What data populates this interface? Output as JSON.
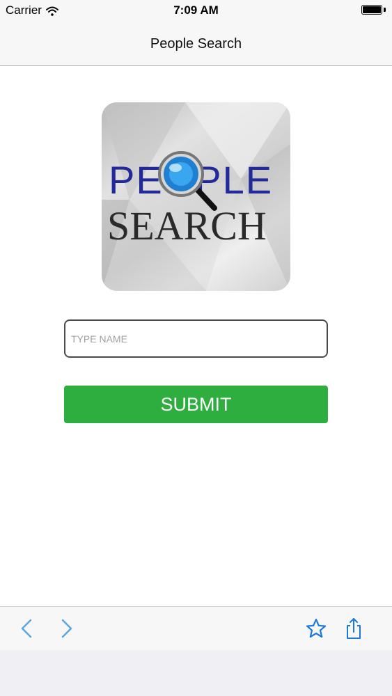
{
  "status_bar": {
    "carrier": "Carrier",
    "time": "7:09 AM",
    "wifi_icon": "wifi-icon",
    "battery_icon": "battery-icon"
  },
  "nav": {
    "title": "People Search"
  },
  "logo": {
    "line1": "PEOPLE",
    "line2": "SEARCH",
    "icon": "magnifying-glass-icon"
  },
  "form": {
    "name_placeholder": "TYPE NAME",
    "name_value": "",
    "submit_label": "SUBMIT",
    "submit_color": "#2eae3f"
  },
  "toolbar": {
    "icons": [
      "chevron-left-icon",
      "chevron-right-icon",
      "star-icon",
      "share-icon"
    ],
    "accent": "#1a7ad6"
  }
}
